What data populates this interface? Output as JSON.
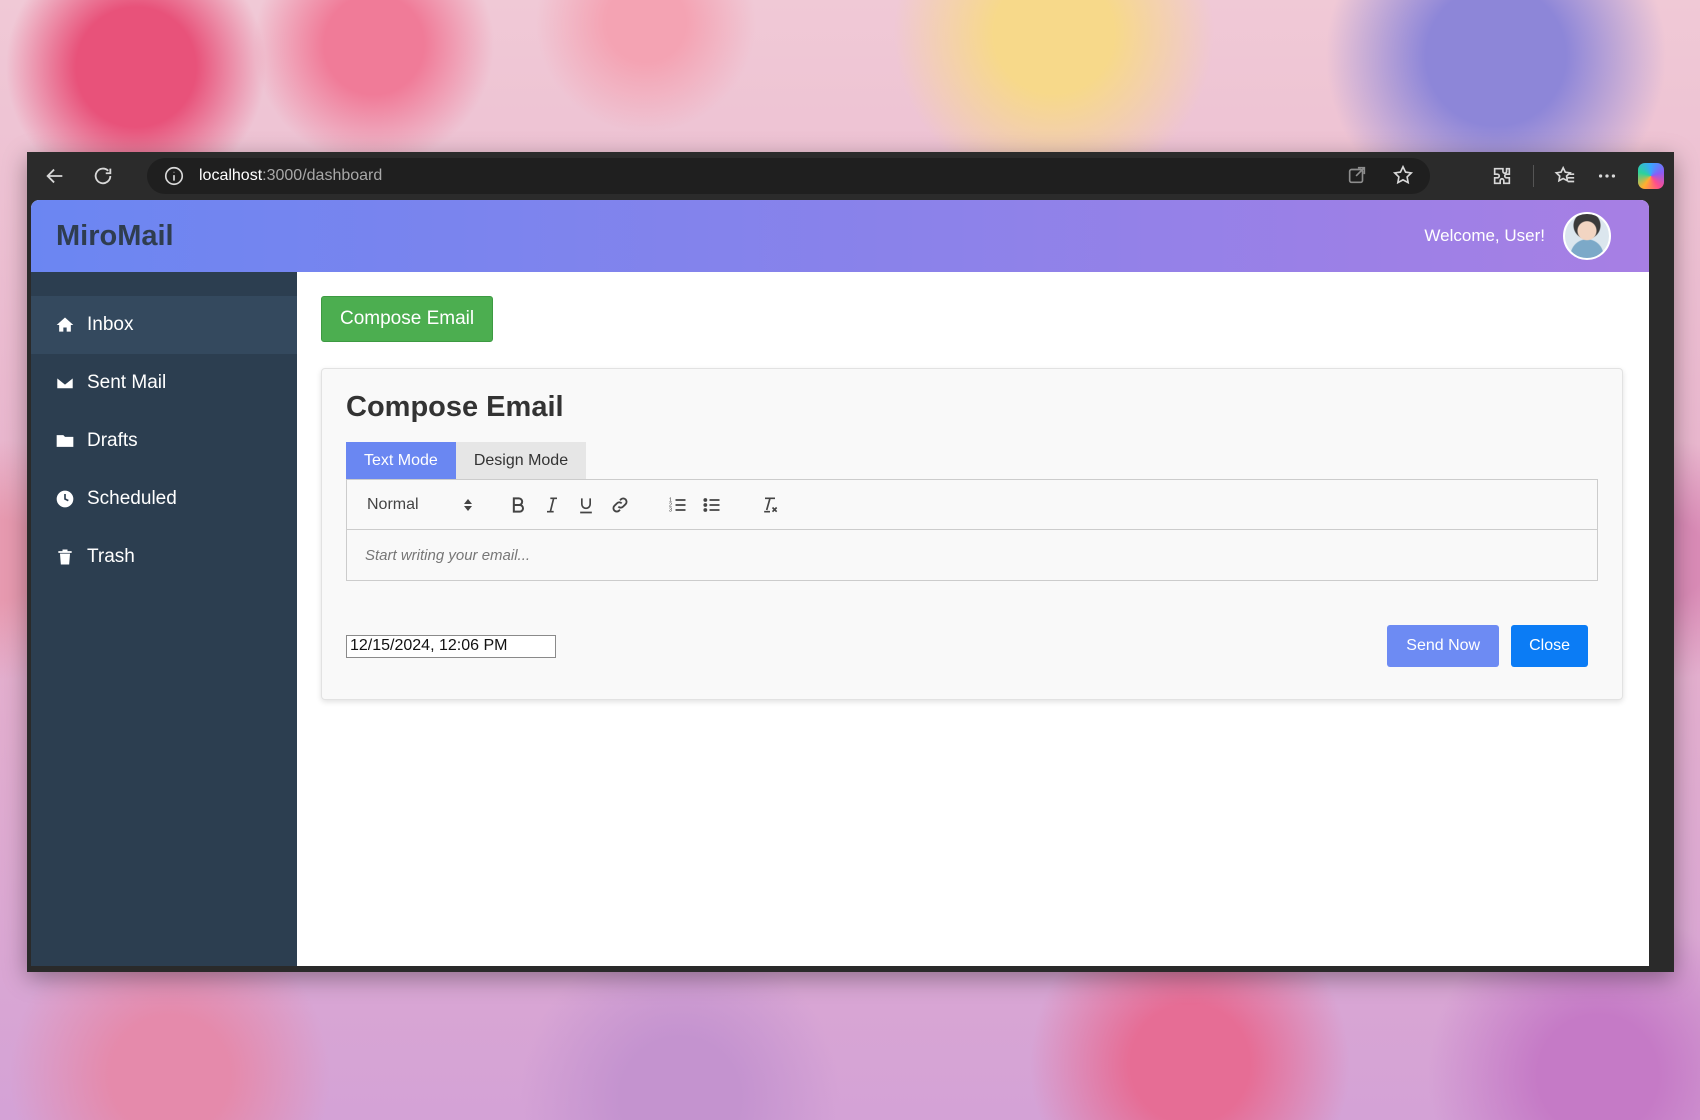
{
  "browser": {
    "url_host": "localhost",
    "url_rest": ":3000/dashboard",
    "icons": [
      "back-icon",
      "reload-icon",
      "info-icon",
      "open-in-app-icon",
      "favorite-star-icon",
      "extensions-icon",
      "favorites-icon",
      "more-icon",
      "copilot-icon"
    ]
  },
  "header": {
    "brand": "MiroMail",
    "welcome": "Welcome, User!"
  },
  "sidebar": {
    "items": [
      {
        "label": "Inbox",
        "icon": "home-icon"
      },
      {
        "label": "Sent Mail",
        "icon": "envelope-icon"
      },
      {
        "label": "Drafts",
        "icon": "folder-icon"
      },
      {
        "label": "Scheduled",
        "icon": "clock-icon"
      },
      {
        "label": "Trash",
        "icon": "trash-icon"
      }
    ],
    "active": "Inbox"
  },
  "main": {
    "compose_button": "Compose Email",
    "card": {
      "title": "Compose Email",
      "tabs": [
        {
          "label": "Text Mode",
          "active": true
        },
        {
          "label": "Design Mode",
          "active": false
        }
      ],
      "toolbar": {
        "format_value": "Normal",
        "icons": [
          "bold-icon",
          "italic-icon",
          "underline-icon",
          "link-icon",
          "ordered-list-icon",
          "bullet-list-icon",
          "clear-format-icon"
        ]
      },
      "editor_placeholder": "Start writing your email...",
      "schedule_value": "12/15/2024, 12:06 PM",
      "send_button": "Send Now",
      "close_button": "Close"
    }
  },
  "colors": {
    "header_start": "#6b86f2",
    "header_end": "#a77fe4",
    "sidebar_bg": "#2c3e50",
    "compose_green": "#4cae50",
    "send_blue": "#6d8bf3",
    "close_blue": "#0b7cf5"
  }
}
